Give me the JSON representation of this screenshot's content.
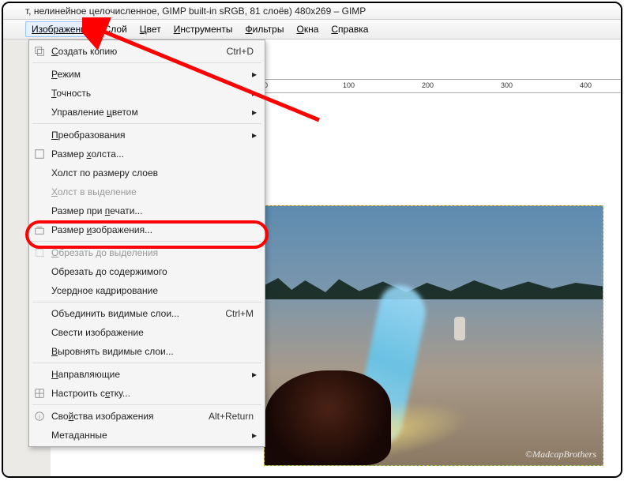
{
  "titlebar": "т, нелинейное целочисленное, GIMP built-in sRGB, 81 слоёв) 480x269 – GIMP",
  "menubar": {
    "image": "Изображение",
    "layer": "Слой",
    "color": "Цвет",
    "tools": "Инструменты",
    "filters": "Фильтры",
    "windows": "Окна",
    "help": "Справка"
  },
  "ruler": {
    "t0": "0",
    "t100": "100",
    "t200": "200",
    "t300": "300",
    "t400": "400"
  },
  "menu": {
    "duplicate": {
      "label": "Создать копию",
      "shortcut": "Ctrl+D"
    },
    "mode": "Режим",
    "precision": "Точность",
    "color_mgmt": "Управление цветом",
    "transforms": "Преобразования",
    "canvas_size": "Размер холста...",
    "fit_canvas": "Холст по размеру слоев",
    "canvas_to_sel": "Холст в выделение",
    "print_size": "Размер при печати...",
    "image_size": "Размер изображения...",
    "crop_to_sel": "Обрезать до выделения",
    "crop_to_content": "Обрезать до содержимого",
    "zealous_crop": "Усердное кадрирование",
    "merge_visible": {
      "label": "Объединить видимые слои...",
      "shortcut": "Ctrl+M"
    },
    "flatten": "Свести изображение",
    "align_visible": "Выровнять видимые слои...",
    "guides": "Направляющие",
    "configure_grid": "Настроить сетку...",
    "properties": {
      "label": "Свойства изображения",
      "shortcut": "Alt+Return"
    },
    "metadata": "Метаданные"
  },
  "watermark": "©MadcapBrothers"
}
